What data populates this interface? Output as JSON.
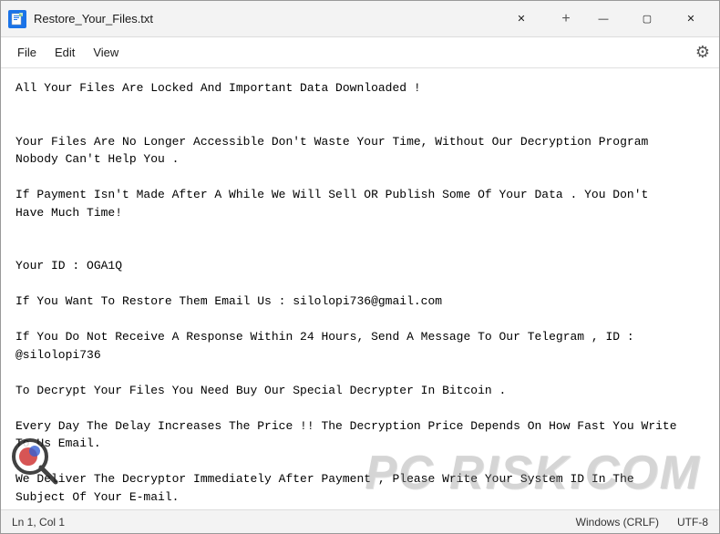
{
  "window": {
    "title": "Restore_Your_Files.txt",
    "close_label": "✕",
    "minimize_label": "—",
    "maximize_label": "▢",
    "new_tab_label": "+"
  },
  "menu": {
    "file_label": "File",
    "edit_label": "Edit",
    "view_label": "View"
  },
  "content": {
    "text": "All Your Files Are Locked And Important Data Downloaded !\n\n\nYour Files Are No Longer Accessible Don't Waste Your Time, Without Our Decryption Program\nNobody Can't Help You .\n\nIf Payment Isn't Made After A While We Will Sell OR Publish Some Of Your Data . You Don't\nHave Much Time!\n\n\nYour ID : OGA1Q\n\nIf You Want To Restore Them Email Us : silolopi736@gmail.com\n\nIf You Do Not Receive A Response Within 24 Hours, Send A Message To Our Telegram , ID :\n@silolopi736\n\nTo Decrypt Your Files You Need Buy Our Special Decrypter In Bitcoin .\n\nEvery Day The Delay Increases The Price !! The Decryption Price Depends On How Fast You Write\nTo Us Email.\n\nWe Deliver The Decryptor Immediately After Payment , Please Write Your System ID In The\nSubject Of Your E-mail.\n\nThis is the guarantee !"
  },
  "status_bar": {
    "position": "Ln 1, Col 1",
    "encoding": "Windows (CRLF)",
    "charset": "UTF-8"
  },
  "watermark": {
    "text": "PC RISK.COM"
  },
  "icons": {
    "notepad": "📄",
    "gear": "⚙"
  }
}
